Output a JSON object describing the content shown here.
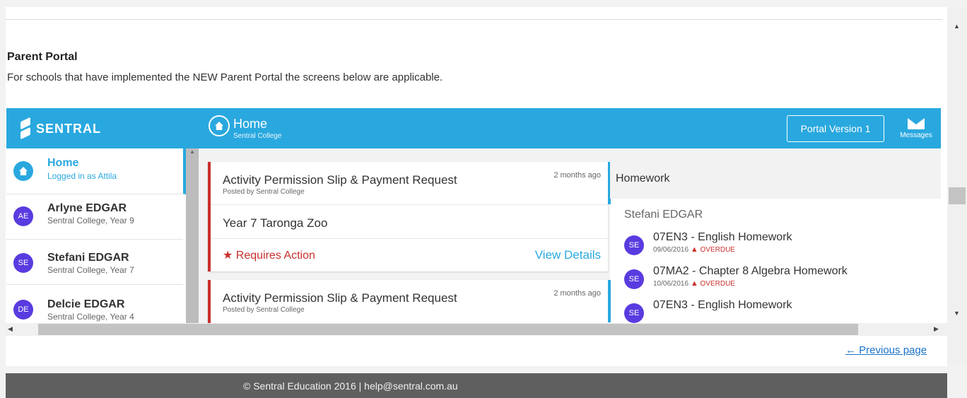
{
  "page": {
    "title": "Parent Portal",
    "intro": "For schools that have implemented the NEW Parent Portal the screens below are applicable."
  },
  "app": {
    "brand": "SENTRAL",
    "header_title": "Home",
    "header_subtitle": "Sentral College",
    "portal_version_button": "Portal Version 1",
    "messages_label": "Messages",
    "accent_color": "#29a8df"
  },
  "sidebar": {
    "items": [
      {
        "initials": "",
        "name": "Home",
        "subtitle": "Logged in as Attila",
        "active": true
      },
      {
        "initials": "AE",
        "name": "Arlyne EDGAR",
        "subtitle": "Sentral College, Year 9"
      },
      {
        "initials": "SE",
        "name": "Stefani EDGAR",
        "subtitle": "Sentral College, Year 7"
      },
      {
        "initials": "DE",
        "name": "Delcie EDGAR",
        "subtitle": "Sentral College, Year 4"
      }
    ]
  },
  "feed": {
    "cards": [
      {
        "title": "Activity Permission Slip & Payment Request",
        "posted_by": "Posted by Sentral College",
        "time": "2 months ago",
        "body": "Year 7 Taronga Zoo",
        "requires_action": "Requires Action",
        "view_details": "View Details"
      },
      {
        "title": "Activity Permission Slip & Payment Request",
        "posted_by": "Posted by Sentral College",
        "time": "2 months ago"
      }
    ]
  },
  "homework": {
    "title": "Homework",
    "student": "Stefani EDGAR",
    "items": [
      {
        "initials": "SE",
        "name": "07EN3 - English Homework",
        "date": "09/06/2016",
        "status": "OVERDUE"
      },
      {
        "initials": "SE",
        "name": "07MA2 - Chapter 8 Algebra Homework",
        "date": "10/06/2016",
        "status": "OVERDUE"
      },
      {
        "initials": "SE",
        "name": "07EN3 - English Homework"
      }
    ]
  },
  "nav": {
    "previous_page": "← Previous page"
  },
  "footer": {
    "text": "© Sentral Education 2016 | help@sentral.com.au"
  }
}
